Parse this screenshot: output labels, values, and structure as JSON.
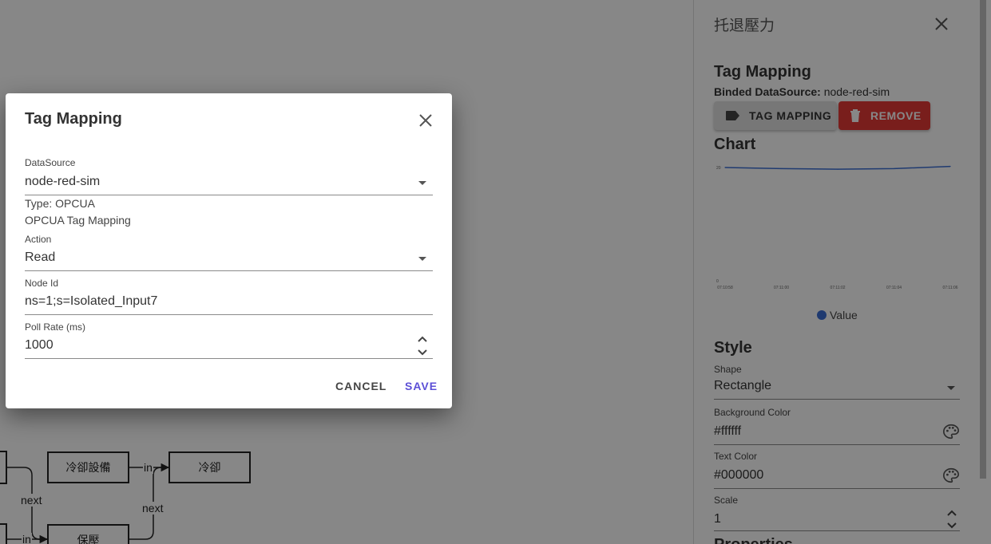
{
  "canvas": {
    "nodes": [
      "冷卻設備",
      "冷卻",
      "保壓"
    ],
    "edge_labels": [
      "in",
      "next",
      "next",
      "in"
    ]
  },
  "panel": {
    "title": "托退壓力",
    "tag_mapping": {
      "heading": "Tag Mapping",
      "binded_label": "Binded DataSource:",
      "binded_value": "node-red-sim",
      "tag_mapping_button": "TAG MAPPING",
      "remove_button": "REMOVE"
    },
    "chart": {
      "heading": "Chart",
      "legend": "Value"
    },
    "style": {
      "heading": "Style",
      "shape_label": "Shape",
      "shape_value": "Rectangle",
      "bg_label": "Background Color",
      "bg_value": "#ffffff",
      "text_color_label": "Text Color",
      "text_color_value": "#000000",
      "scale_label": "Scale",
      "scale_value": "1"
    },
    "properties_heading": "Properties"
  },
  "chart_data": {
    "type": "line",
    "x": [
      "07:10:58",
      "07:11:00",
      "07:11:02",
      "07:11:04",
      "07:11:06"
    ],
    "series": [
      {
        "name": "Value",
        "values": [
          20,
          19.8,
          19.7,
          19.8,
          20.2
        ]
      }
    ],
    "ylim": [
      0,
      20
    ],
    "yticks": [
      "20",
      "0"
    ],
    "legend": "bottom",
    "colors": {
      "series": "#3b6fd4"
    }
  },
  "dialog": {
    "title": "Tag Mapping",
    "datasource_label": "DataSource",
    "datasource_value": "node-red-sim",
    "type_text": "Type: OPCUA",
    "mapping_text": "OPCUA Tag Mapping",
    "action_label": "Action",
    "action_value": "Read",
    "node_id_label": "Node Id",
    "node_id_value": "ns=1;s=Isolated_Input7",
    "poll_rate_label": "Poll Rate (ms)",
    "poll_rate_value": "1000",
    "cancel_button": "CANCEL",
    "save_button": "SAVE"
  },
  "colors": {
    "accent": "#5c4fd6",
    "danger": "#e53935"
  }
}
